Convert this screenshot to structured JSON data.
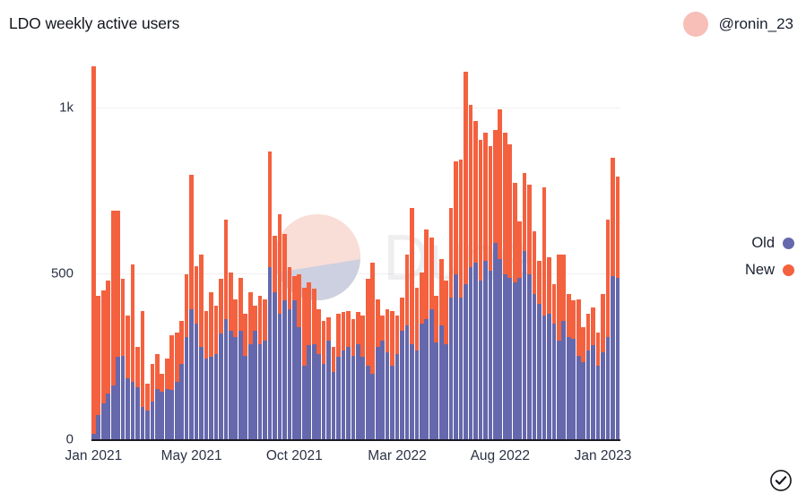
{
  "header": {
    "title": "LDO weekly active users",
    "attribution_handle": "@ronin_23",
    "avatar_color": "#f7bfb7"
  },
  "legend": {
    "position": "right",
    "items": [
      {
        "label": "Old",
        "color": "#6568ac"
      },
      {
        "label": "New",
        "color": "#f4613f"
      }
    ]
  },
  "watermark": {
    "text": "Dune",
    "logo_top_color": "#f9ddd7",
    "logo_bottom_color": "#cdd0e0"
  },
  "footer": {
    "badge_icon": "check-circle-icon"
  },
  "chart_data": {
    "type": "bar",
    "stacked": true,
    "title": "LDO weekly active users",
    "xlabel": "",
    "ylabel": "",
    "ylim": [
      0,
      1150
    ],
    "grid": true,
    "y_ticks": [
      {
        "value": 0,
        "label": "0"
      },
      {
        "value": 500,
        "label": "500"
      },
      {
        "value": 1000,
        "label": "1k"
      }
    ],
    "x_ticks": [
      {
        "index": 0,
        "label": "Jan 2021"
      },
      {
        "index": 20,
        "label": "May 2021"
      },
      {
        "index": 41,
        "label": "Oct 2021"
      },
      {
        "index": 62,
        "label": "Mar 2022"
      },
      {
        "index": 83,
        "label": "Aug 2022"
      },
      {
        "index": 104,
        "label": "Jan 2023"
      }
    ],
    "categories": [
      "Jan 2021",
      "",
      "",
      "",
      "",
      "",
      "",
      "",
      "",
      "",
      "",
      "",
      "",
      "",
      "",
      "",
      "",
      "",
      "",
      "",
      "May 2021",
      "",
      "",
      "",
      "",
      "",
      "",
      "",
      "",
      "",
      "",
      "",
      "",
      "",
      "",
      "",
      "",
      "",
      "",
      "",
      "",
      "Oct 2021",
      "",
      "",
      "",
      "",
      "",
      "",
      "",
      "",
      "",
      "",
      "",
      "",
      "",
      "",
      "",
      "",
      "",
      "",
      "",
      "Mar 2022",
      "",
      "",
      "",
      "",
      "",
      "",
      "",
      "",
      "",
      "",
      "",
      "",
      "",
      "",
      "",
      "",
      "",
      "",
      "",
      "Aug 2022",
      "",
      "",
      "",
      "",
      "",
      "",
      "",
      "",
      "",
      "",
      "",
      "",
      "",
      "",
      "",
      "",
      "",
      "",
      "",
      "Jan 2023",
      "",
      ""
    ],
    "series": [
      {
        "name": "Old",
        "color": "#6568ac",
        "values": [
          20,
          75,
          110,
          140,
          165,
          250,
          255,
          185,
          175,
          160,
          100,
          90,
          115,
          155,
          145,
          155,
          150,
          175,
          230,
          310,
          395,
          350,
          280,
          245,
          250,
          260,
          320,
          365,
          330,
          310,
          330,
          255,
          290,
          330,
          290,
          300,
          520,
          445,
          380,
          420,
          395,
          420,
          340,
          225,
          285,
          290,
          260,
          230,
          300,
          205,
          250,
          270,
          280,
          255,
          290,
          250,
          225,
          200,
          280,
          300,
          265,
          225,
          260,
          330,
          345,
          290,
          270,
          350,
          365,
          395,
          295,
          345,
          290,
          430,
          500,
          430,
          470,
          520,
          535,
          480,
          540,
          510,
          595,
          545,
          500,
          490,
          475,
          490,
          570,
          500,
          440,
          410,
          375,
          380,
          350,
          300,
          360,
          310,
          305,
          255,
          235,
          270,
          285,
          225,
          265,
          310,
          495,
          490
        ]
      },
      {
        "name": "New",
        "color": "#f4613f",
        "values": [
          1105,
          360,
          340,
          340,
          525,
          440,
          230,
          190,
          355,
          120,
          290,
          80,
          115,
          105,
          55,
          90,
          165,
          150,
          130,
          190,
          405,
          175,
          280,
          145,
          195,
          145,
          165,
          300,
          175,
          115,
          160,
          125,
          155,
          75,
          145,
          125,
          350,
          170,
          300,
          200,
          125,
          75,
          160,
          235,
          190,
          165,
          135,
          130,
          70,
          75,
          130,
          115,
          110,
          110,
          95,
          125,
          260,
          335,
          145,
          75,
          130,
          165,
          115,
          100,
          215,
          410,
          190,
          155,
          270,
          215,
          140,
          200,
          190,
          270,
          340,
          415,
          640,
          490,
          425,
          425,
          385,
          375,
          340,
          450,
          425,
          400,
          300,
          170,
          235,
          270,
          190,
          130,
          385,
          170,
          120,
          260,
          200,
          130,
          115,
          170,
          105,
          110,
          115,
          100,
          175,
          355,
          355,
          305
        ]
      }
    ]
  }
}
